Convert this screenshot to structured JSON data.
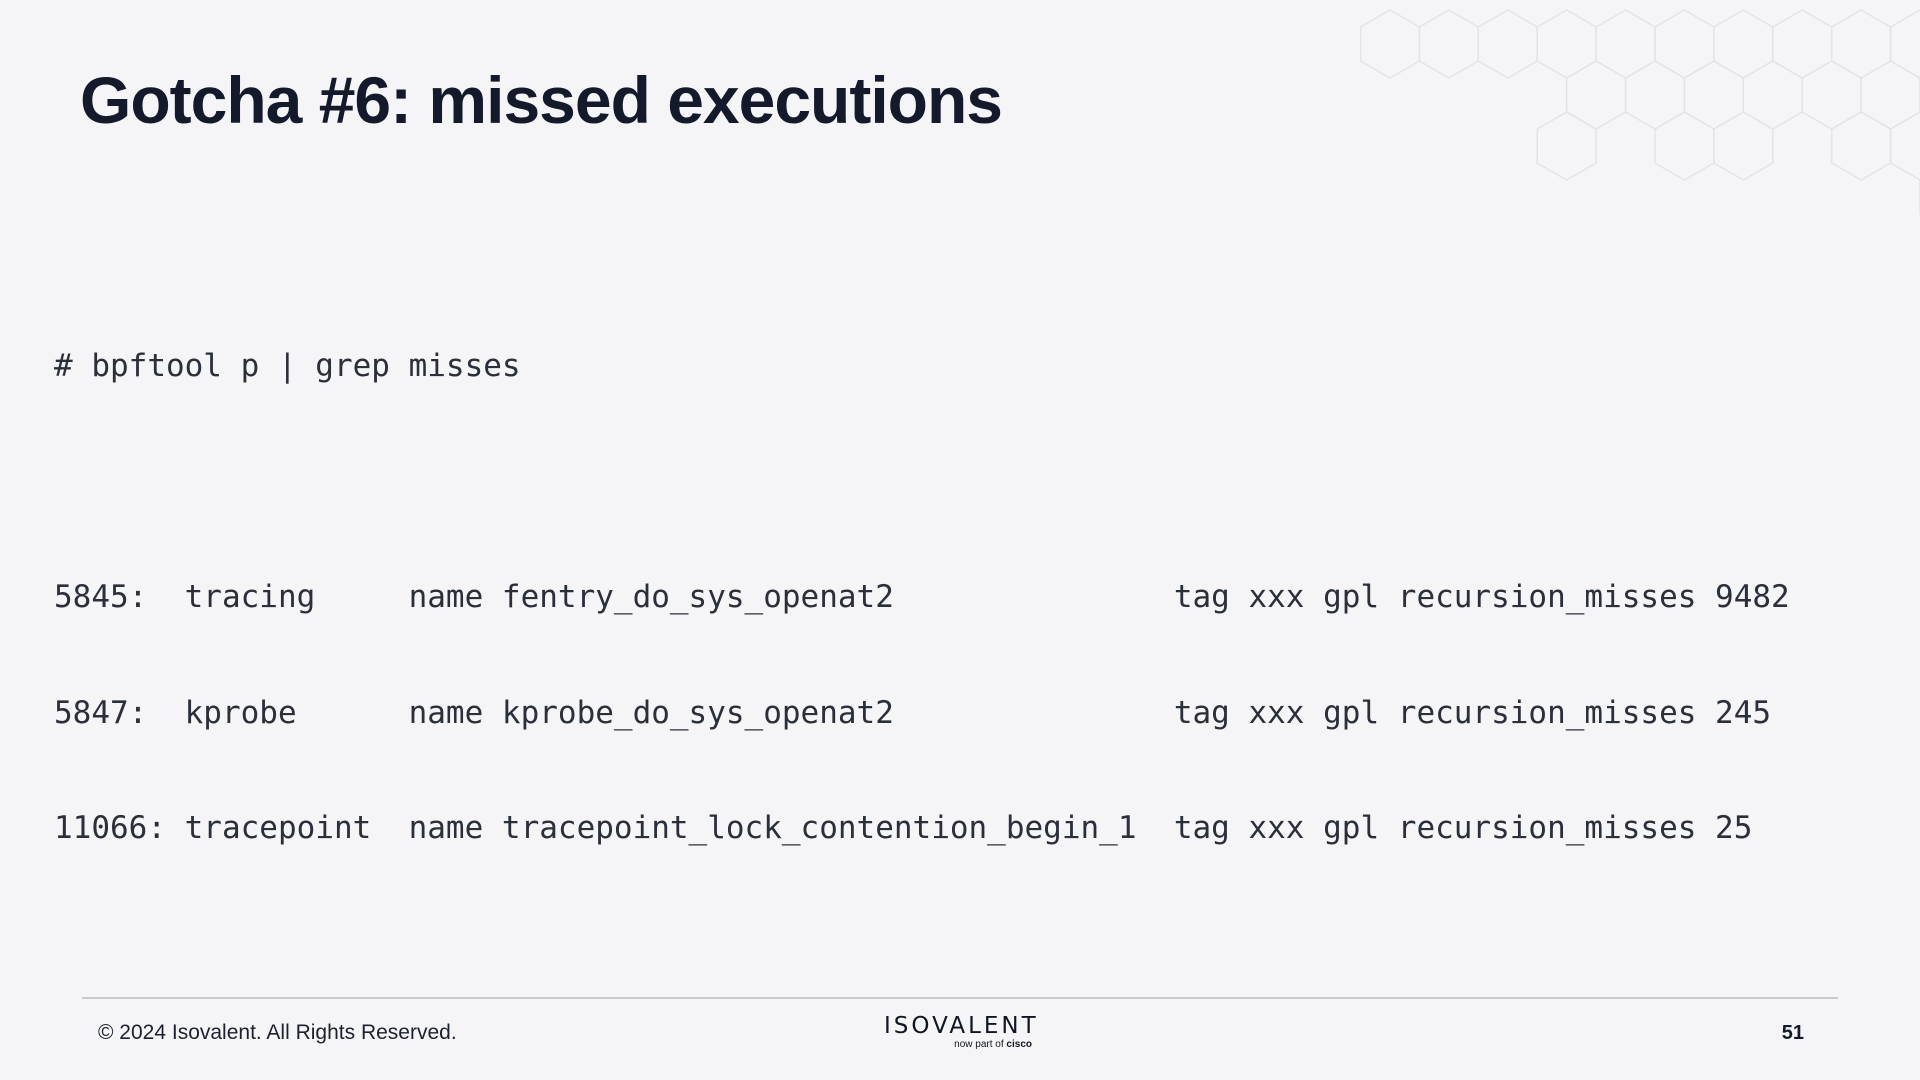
{
  "slide": {
    "title": "Gotcha #6: missed executions",
    "page_number": "51"
  },
  "terminal": {
    "command": "# bpftool p | grep misses",
    "lines": [
      "5845:  tracing     name fentry_do_sys_openat2               tag xxx gpl recursion_misses 9482",
      "5847:  kprobe      name kprobe_do_sys_openat2               tag xxx gpl recursion_misses 245",
      "11066: tracepoint  name tracepoint_lock_contention_begin_1  tag xxx gpl recursion_misses 25"
    ]
  },
  "footer": {
    "copyright": "© 2024 Isovalent. All Rights Reserved.",
    "logo_word": "ISOVALENT",
    "logo_sub_prefix": "now part of",
    "logo_sub_brand": "cisco"
  },
  "colors": {
    "background": "#f5f5f7",
    "title": "#141a2b",
    "code_text": "#2b2f3a",
    "hex_pattern": "#e2e4e9",
    "footer_rule": "#c9cbd1"
  }
}
